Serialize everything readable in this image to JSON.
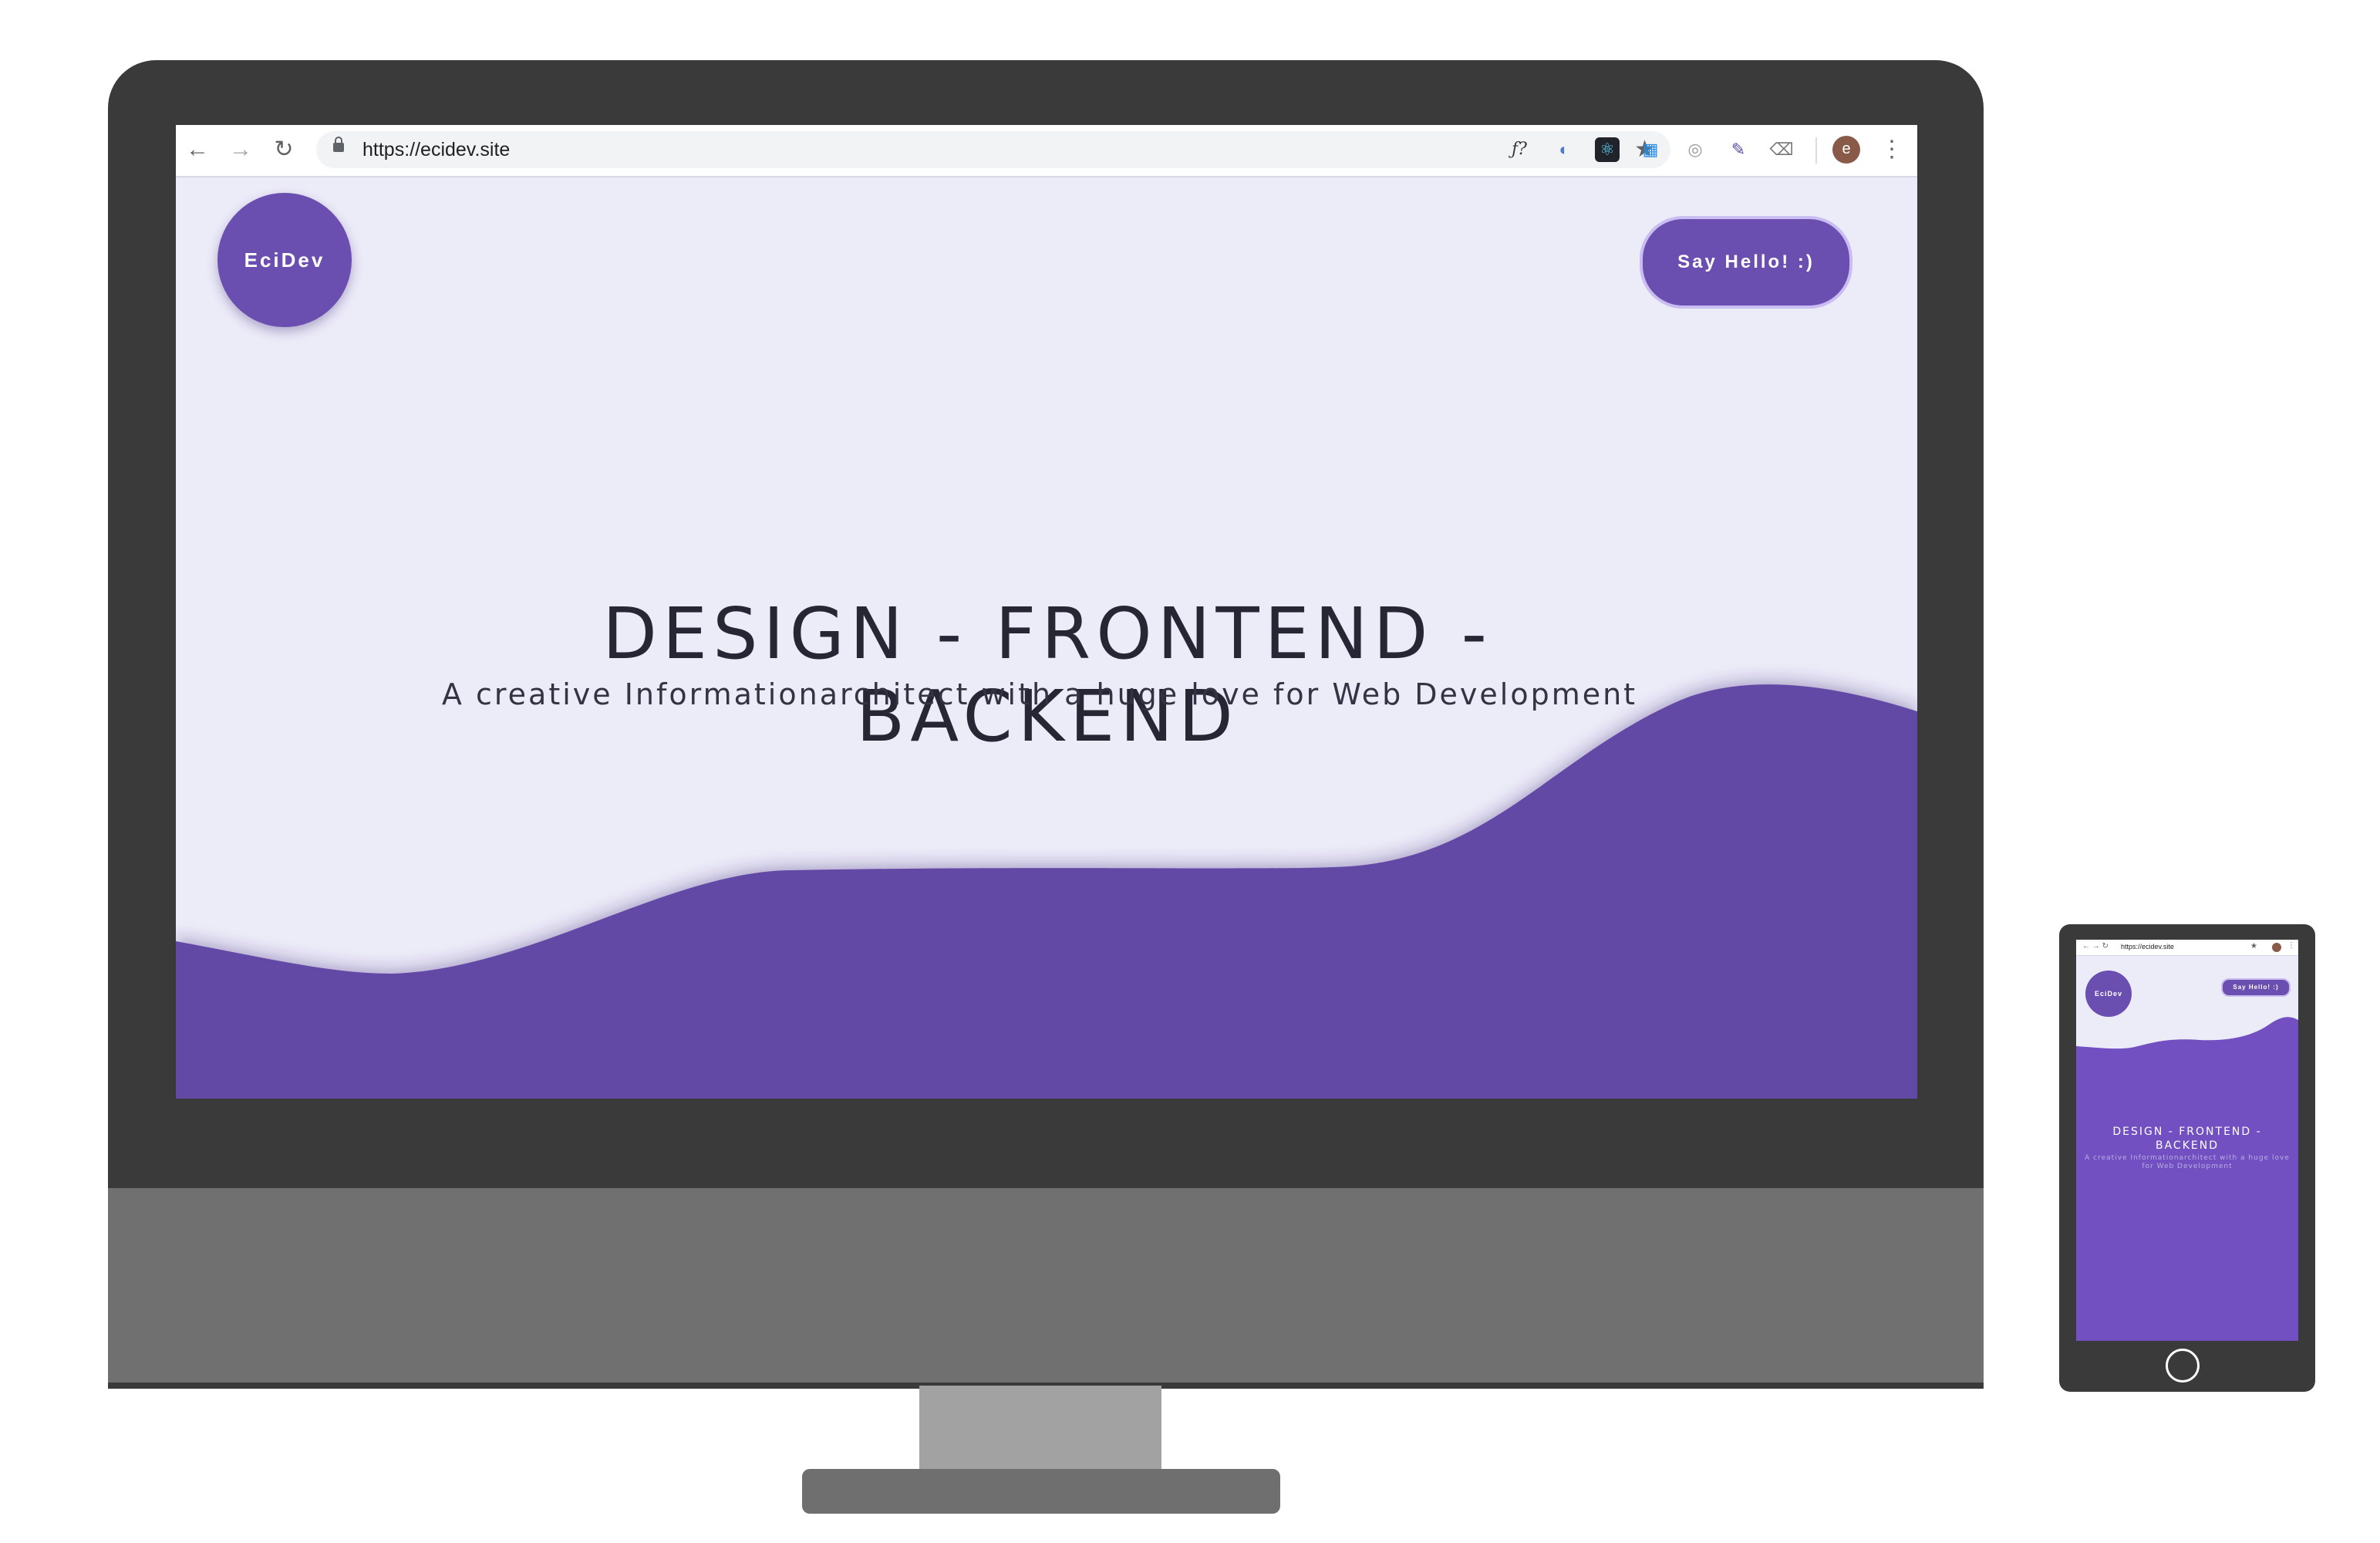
{
  "browser": {
    "url": "https://ecidev.site",
    "avatar_letter": "e"
  },
  "extensions": [
    {
      "name": "whatfont-icon",
      "glyph": "ƒ?"
    },
    {
      "name": "extension-icon-blue",
      "glyph": "◐"
    },
    {
      "name": "react-devtools-icon",
      "glyph": "⚛"
    },
    {
      "name": "calendar-extension-icon",
      "glyph": "▦"
    },
    {
      "name": "dropper-extension-icon",
      "glyph": "◎"
    },
    {
      "name": "eyedropper-icon",
      "glyph": "✎"
    },
    {
      "name": "eraser-extension-icon",
      "glyph": "⌫"
    }
  ],
  "site": {
    "logo": "EciDev",
    "cta": "Say Hello! :)",
    "headline": "DESIGN - FRONTEND - BACKEND",
    "subheadline": "A creative Informationarchitect with a huge love for Web Development"
  },
  "mobile": {
    "url": "https://ecidev.site",
    "logo": "EciDev",
    "cta": "Say Hello! :)",
    "headline": "DESIGN - FRONTEND - BACKEND",
    "subheadline": "A creative Informationarchitect with a huge love for Web Development"
  },
  "colors": {
    "accent": "#6a4eb0",
    "wave": "#6249a6",
    "page_bg": "#ecebf8"
  }
}
